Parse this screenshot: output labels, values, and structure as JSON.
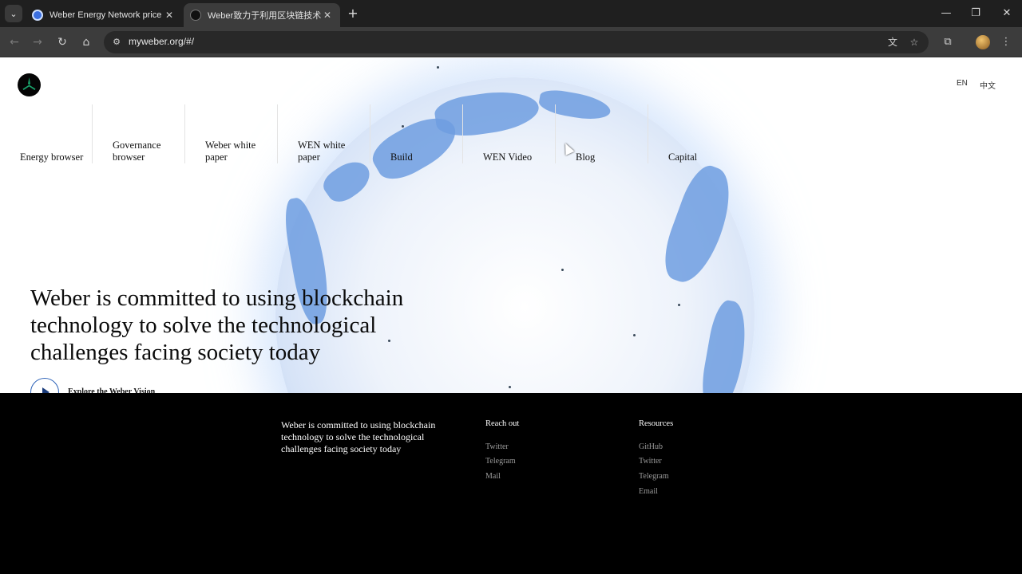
{
  "browser": {
    "tabs": [
      {
        "title": "Weber Energy Network price to",
        "active": false
      },
      {
        "title": "Weber致力于利用区块链技术解",
        "active": true
      }
    ],
    "url": "myweber.org/#/"
  },
  "header": {
    "languages": [
      "EN",
      "中文"
    ]
  },
  "nav": {
    "items": [
      {
        "label": "Energy browser"
      },
      {
        "label": "Governance browser"
      },
      {
        "label": "Weber white paper"
      },
      {
        "label": "WEN white paper"
      },
      {
        "label": "Build"
      },
      {
        "label": "WEN Video"
      },
      {
        "label": "Blog"
      },
      {
        "label": "Capital"
      }
    ]
  },
  "hero": {
    "title": "Weber is committed to using blockchain technology to solve the technological challenges facing society today",
    "explore_label": "Explore the Weber Vision"
  },
  "footer": {
    "tagline": "Weber is committed to using blockchain technology to solve the technological challenges facing society today",
    "reach_out": {
      "title": "Reach out",
      "links": [
        "Twitter",
        "Telegram",
        "Mail"
      ]
    },
    "resources": {
      "title": "Resources",
      "links": [
        "GitHub",
        "Twitter",
        "Telegram",
        "Email"
      ]
    }
  },
  "colors": {
    "accent": "#2e63b8",
    "footer_bg": "#000000",
    "chrome_bg": "#1f1f1f"
  }
}
